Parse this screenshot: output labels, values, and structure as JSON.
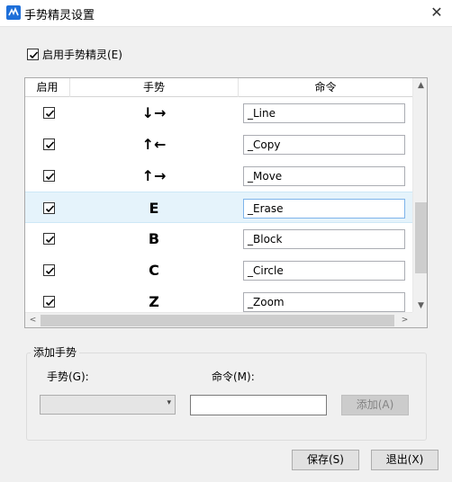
{
  "window": {
    "title": "手势精灵设置",
    "close_glyph": "✕"
  },
  "enable_all": {
    "label": "启用手势精灵(E)",
    "checked": true
  },
  "table": {
    "headers": {
      "enable": "启用",
      "gesture": "手势",
      "command": "命令"
    },
    "rows": [
      {
        "enabled": true,
        "gesture": "↓→",
        "command": "_Line",
        "selected": false
      },
      {
        "enabled": true,
        "gesture": "↑←",
        "command": "_Copy",
        "selected": false
      },
      {
        "enabled": true,
        "gesture": "↑→",
        "command": "_Move",
        "selected": false
      },
      {
        "enabled": true,
        "gesture": "E",
        "command": "_Erase",
        "selected": true
      },
      {
        "enabled": true,
        "gesture": "B",
        "command": "_Block",
        "selected": false
      },
      {
        "enabled": true,
        "gesture": "C",
        "command": "_Circle",
        "selected": false
      },
      {
        "enabled": true,
        "gesture": "Z",
        "command": "_Zoom",
        "selected": false
      }
    ],
    "scroll": {
      "up": "▲",
      "down": "▼",
      "left": "<",
      "right": ">"
    }
  },
  "add_gesture": {
    "group_title": "添加手势",
    "gesture_label": "手势(G):",
    "gesture_value": "",
    "command_label": "命令(M):",
    "command_value": "",
    "add_button": "添加(A)",
    "combo_arrow": "▾"
  },
  "footer": {
    "save_button": "保存(S)",
    "exit_button": "退出(X)"
  },
  "colors": {
    "selected_row": "#e5f3fb",
    "accent": "#0078d7"
  }
}
